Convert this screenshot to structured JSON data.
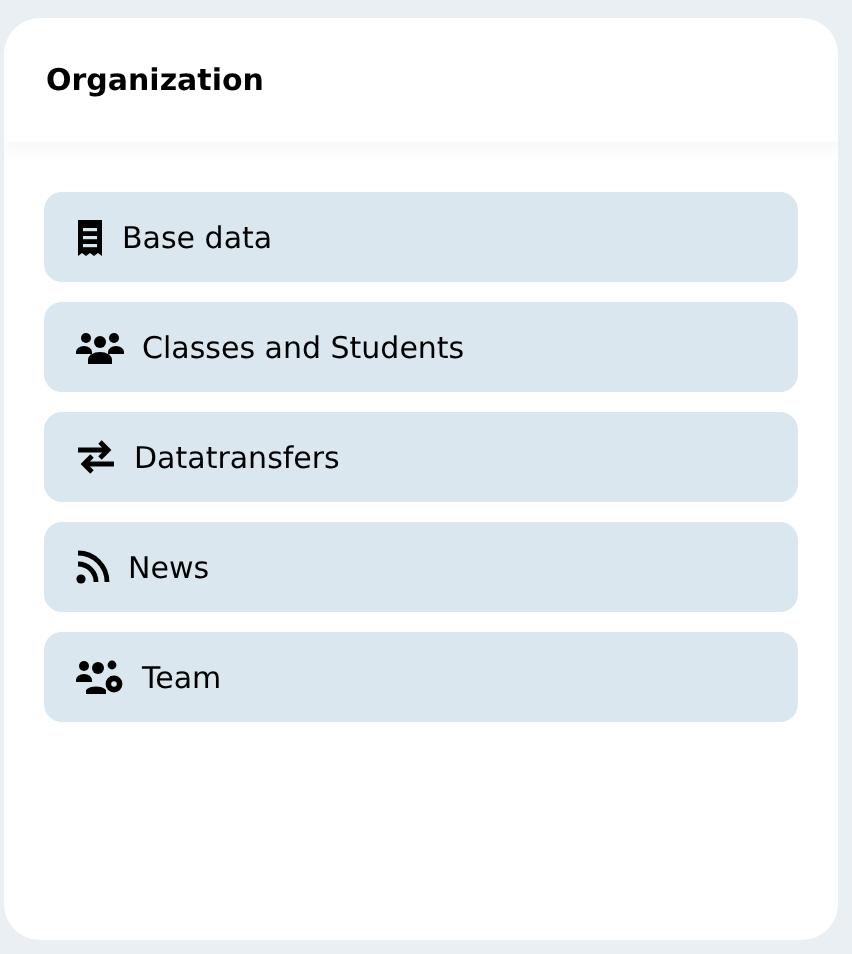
{
  "panel": {
    "title": "Organization"
  },
  "menu": [
    {
      "kind": "receipt",
      "label": "Base data"
    },
    {
      "kind": "users",
      "label": "Classes and Students"
    },
    {
      "kind": "transfer",
      "label": "Datatransfers"
    },
    {
      "kind": "rss",
      "label": "News"
    },
    {
      "kind": "team",
      "label": "Team"
    }
  ]
}
